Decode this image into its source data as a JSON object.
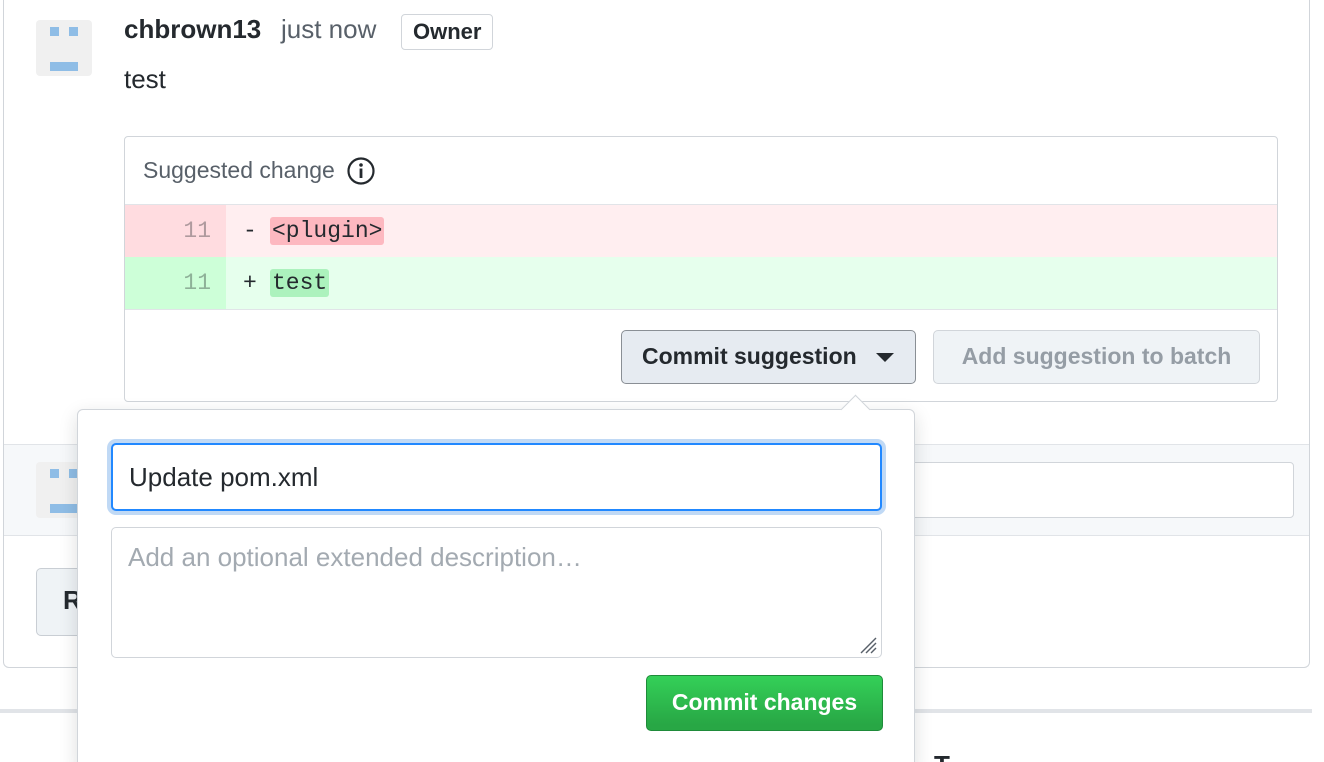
{
  "comment": {
    "author": "chbrown13",
    "time": "just now",
    "badge": "Owner",
    "body": "test"
  },
  "suggestion": {
    "header": "Suggested change",
    "deleted_line": {
      "number": "11",
      "sign": "-",
      "code": "<plugin>"
    },
    "added_line": {
      "number": "11",
      "sign": "+",
      "code": "test"
    },
    "commit_button_label": "Commit suggestion",
    "batch_button_label": "Add suggestion to batch"
  },
  "background": {
    "resolve_button_partial": "R",
    "peek_text": "T"
  },
  "commit_popover": {
    "title_value": "Update pom.xml",
    "description_placeholder": "Add an optional extended description…",
    "commit_changes_label": "Commit changes"
  },
  "colors": {
    "accent_blue": "#2188ff",
    "commit_green": "#28a745",
    "deletion_bg": "#ffeef0",
    "addition_bg": "#e6ffed",
    "avatar_blue": "#8fbde6"
  },
  "icons": {
    "info": "info-icon",
    "caret": "caret-down-icon",
    "resize": "resize-handle-icon"
  }
}
